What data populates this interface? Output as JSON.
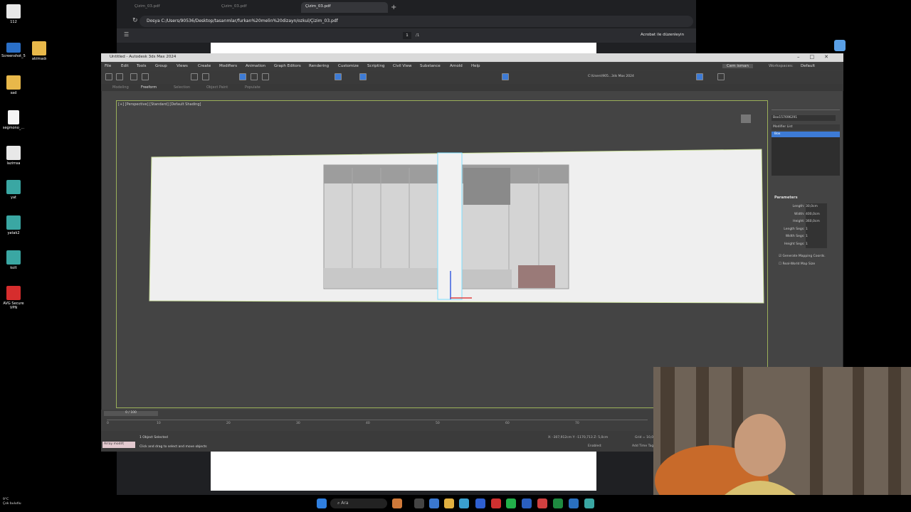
{
  "desktop": {
    "icons": [
      {
        "label": "112",
        "color": "#e8e8e8"
      },
      {
        "label": "Screenshot_5",
        "color": "#2a6fc7"
      },
      {
        "label": "atılmadı",
        "color": "#e8b84a"
      },
      {
        "label": "sad",
        "color": "#e8b84a"
      },
      {
        "label": "segmono_...",
        "color": "#f4f4f4"
      },
      {
        "label": "lazimsa",
        "color": "#e8e8e8"
      },
      {
        "label": "yat",
        "color": "#3aa7a3"
      },
      {
        "label": "yatak2",
        "color": "#3aa7a3"
      },
      {
        "label": "kolt",
        "color": "#3aa7a3"
      },
      {
        "label": "AVG Secure VPN",
        "color": "#d62d2d"
      }
    ],
    "weather": "Çok bulutlu",
    "temp": "9°C"
  },
  "taskbar": {
    "search": "Ara"
  },
  "browser": {
    "tabs": [
      "Çizim_03.pdf",
      "Çizim_03.pdf",
      "Çizim_03.pdf"
    ],
    "address": "Dosya  C:/Users/90536/Desktop/tasarımlar/furkan%20melin%20dizayn/ozkul/Çizim_03.pdf",
    "page_current": "1",
    "page_total": "/1",
    "acrobat_label": "Acrobat ile düzenleyin"
  },
  "max": {
    "title": "Untitled - Autodesk 3ds Max 2024",
    "menus": [
      "File",
      "Edit",
      "Tools",
      "Group",
      "Views",
      "Create",
      "Modifiers",
      "Animation",
      "Graph Editors",
      "Rendering",
      "Customize",
      "Scripting",
      "Civil View",
      "Substance",
      "Arnold",
      "Help"
    ],
    "user": "Cem isman",
    "workspace_label": "Workspaces:",
    "workspace_value": "Default",
    "path": "C:\\Users\\905...3ds Max 2024",
    "ribbon_tabs": [
      "Modeling",
      "Freeform",
      "Selection",
      "Object Paint",
      "Populate"
    ],
    "viewport_label": "[+] [Perspective] [Standard] [Default Shading]",
    "object_name": "Box157696291",
    "modifier_list": "Modifier List",
    "modifier_stack_item": "Box",
    "params_title": "Parameters",
    "params": [
      {
        "label": "Length:",
        "value": "30,0cm"
      },
      {
        "label": "Width:",
        "value": "400,0cm"
      },
      {
        "label": "Height:",
        "value": "360,0cm"
      },
      {
        "label": "Length Segs:",
        "value": "1"
      },
      {
        "label": "Width Segs:",
        "value": "1"
      },
      {
        "label": "Height Segs:",
        "value": "1"
      }
    ],
    "checks": [
      "Generate Mapping Coords.",
      "Real-World Map Size"
    ],
    "time_slider": "0 / 100",
    "ruler_ticks": [
      "0",
      "5",
      "10",
      "15",
      "20",
      "25",
      "30",
      "35",
      "40",
      "45",
      "50",
      "55",
      "60",
      "65",
      "70",
      "75"
    ],
    "status_selected": "1 Object Selected",
    "status_hint": "Click and drag to select and move objects",
    "script_label": "Array modif(",
    "coords": "X: -307,912cm  Y: -1170,713  Z: 5,0cm",
    "grid": "Grid = 10,0",
    "enabled": "Enabled:",
    "add_time_tag": "Add Time Tag"
  },
  "colors": {
    "viewport_bg": "#444444",
    "viewport_border": "#9bb05a",
    "selection_cyan": "#7fe0ff",
    "panel_highlight": "#3d7bd6"
  }
}
